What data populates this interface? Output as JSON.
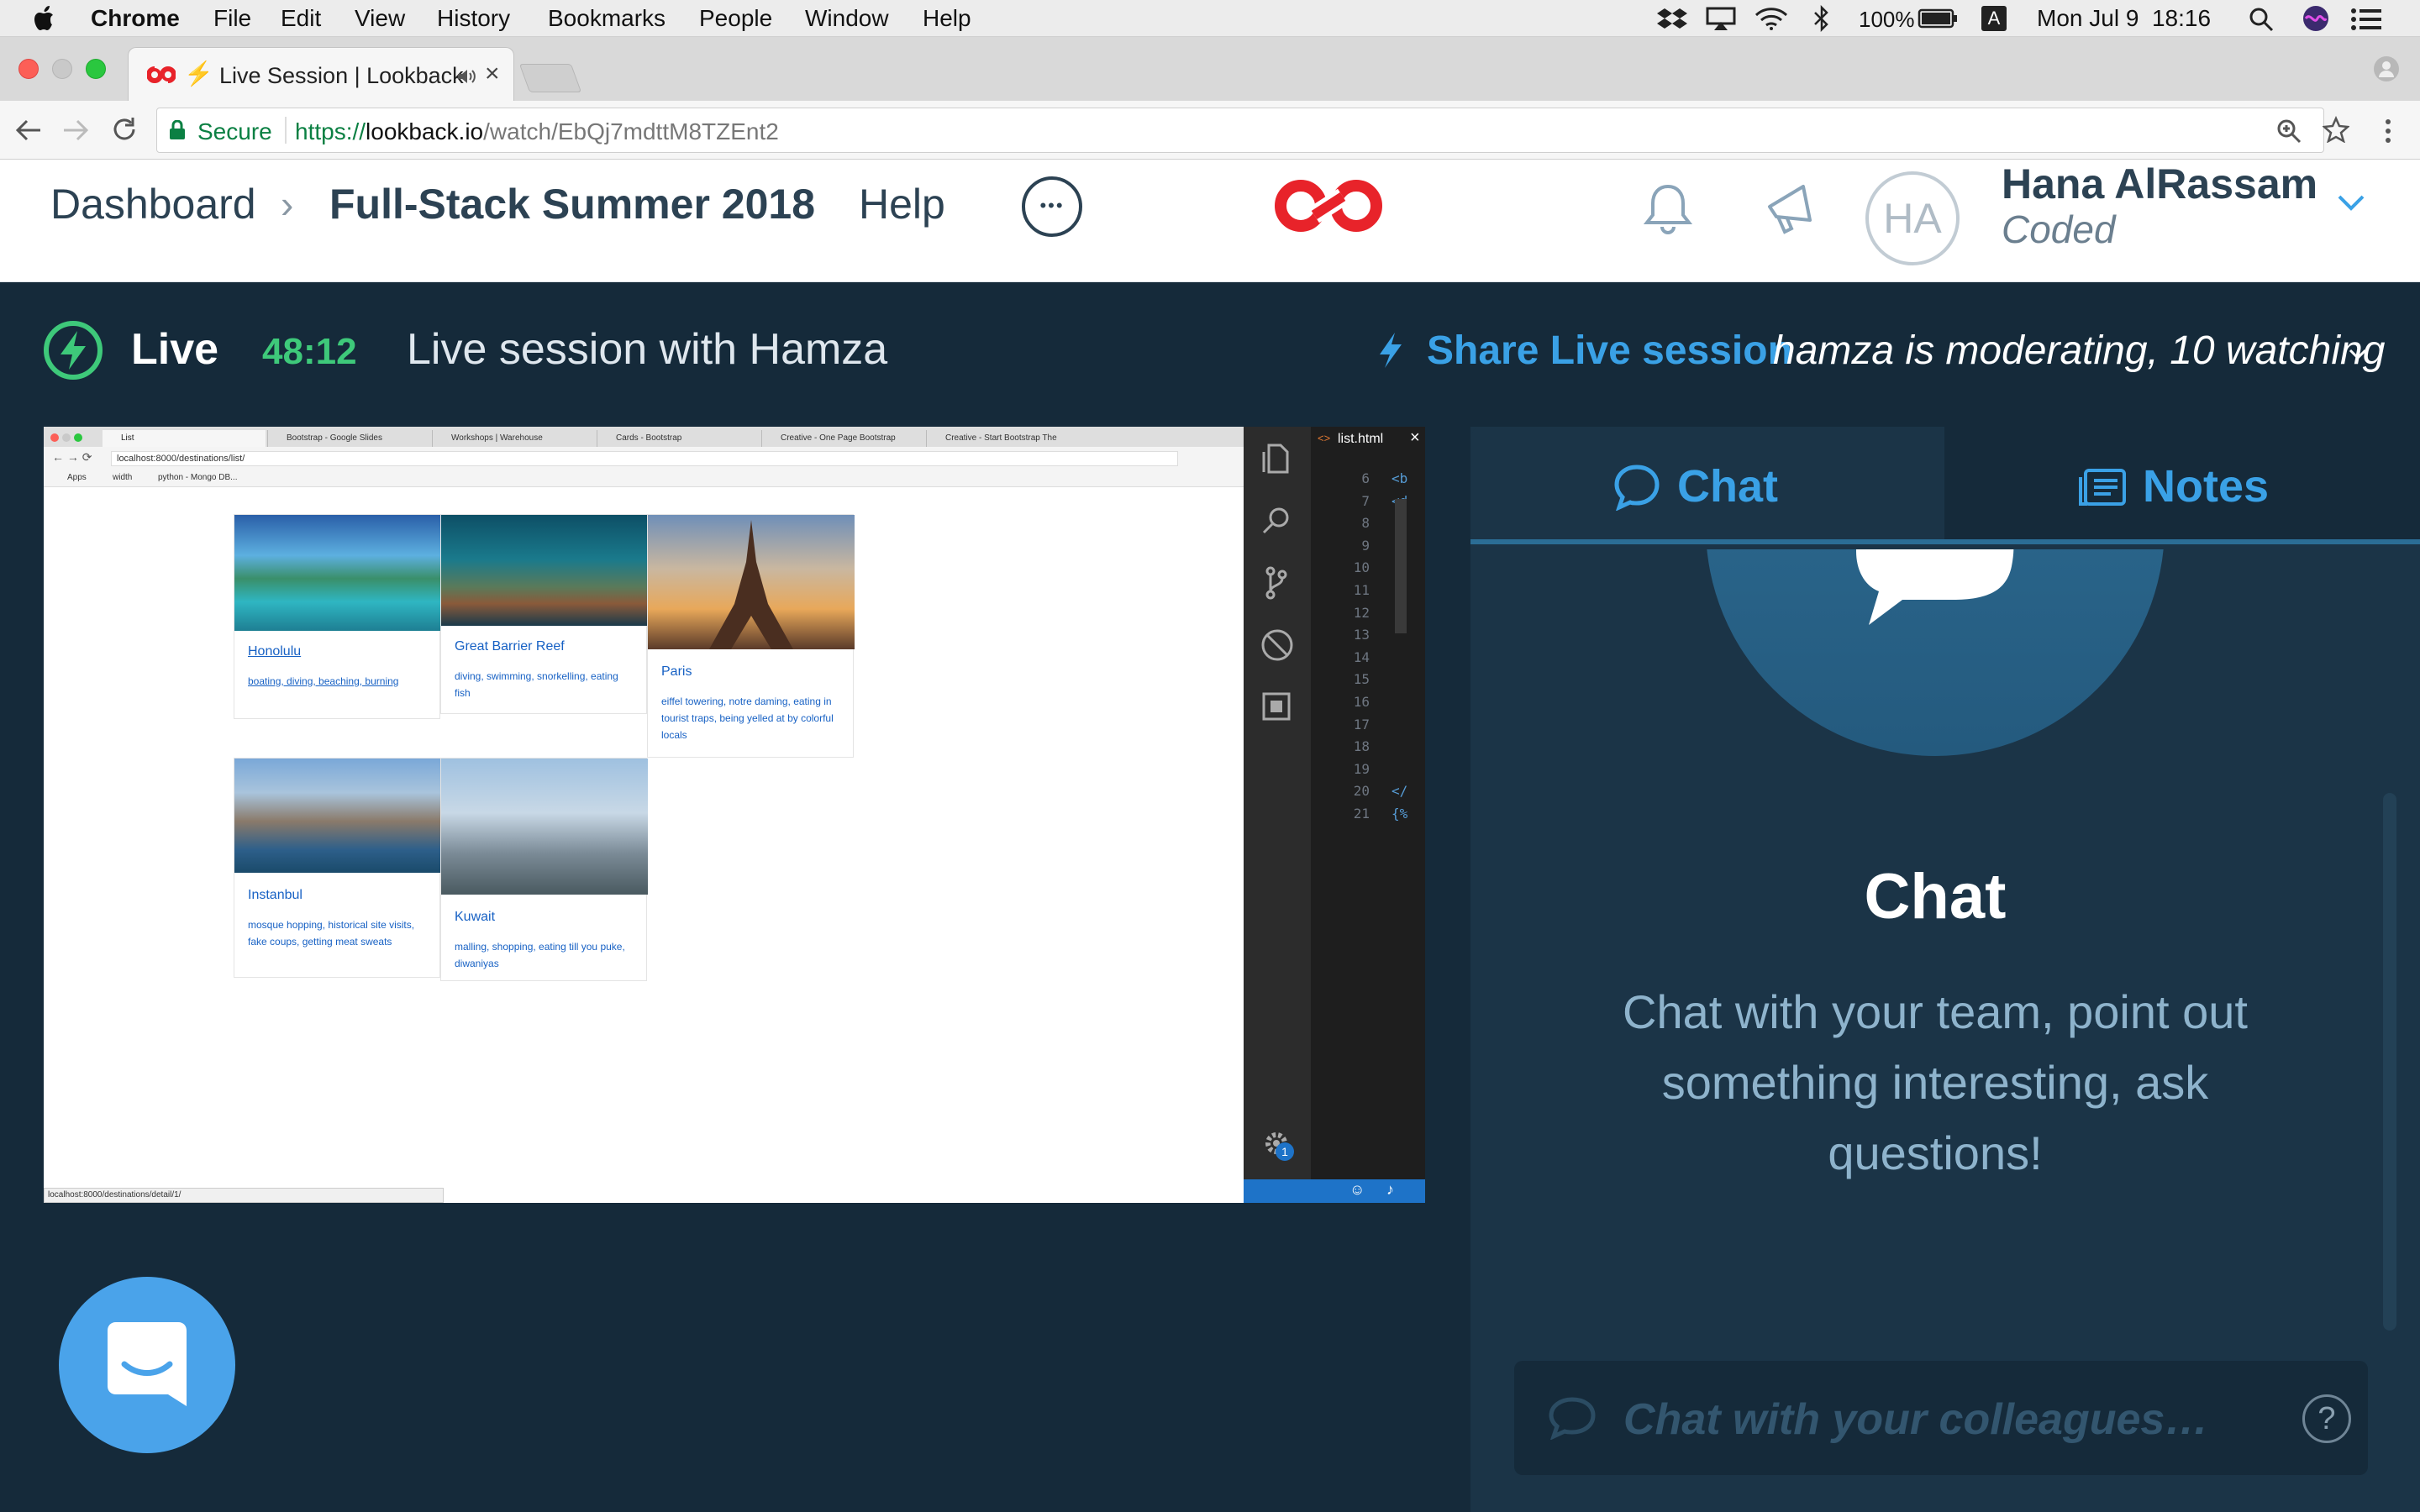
{
  "menubar": {
    "app": "Chrome",
    "items": [
      "File",
      "Edit",
      "View",
      "History",
      "Bookmarks",
      "People",
      "Window",
      "Help"
    ],
    "battery": "100%",
    "input_source": "A",
    "datetime": "Mon Jul 9  18:16"
  },
  "browser": {
    "tab_title": "Live Session | Lookback",
    "secure_label": "Secure",
    "url_scheme": "https://",
    "url_host": "lookback.io",
    "url_path": "/watch/EbQj7mdttM8TZEnt2"
  },
  "header": {
    "dashboard": "Dashboard",
    "breadcrumb_sep": "›",
    "project": "Full-Stack Summer 2018",
    "help": "Help",
    "more": "•••",
    "avatar_initials": "HA",
    "user_name": "Hana AlRassam",
    "user_org": "Coded",
    "colors": {
      "brand": "#e8232a",
      "text": "#2c4253"
    }
  },
  "session": {
    "live_label": "Live",
    "timer": "48:12",
    "title": "Live session with Hamza",
    "share_label": "Share Live session",
    "status": "hamza is moderating, 10 watching",
    "colors": {
      "live_green": "#3ec97a",
      "share_blue": "#3aa1e6"
    }
  },
  "shared_screen": {
    "tabs": [
      "List",
      "Bootstrap - Google Slides",
      "Workshops | Warehouse",
      "Cards - Bootstrap",
      "Creative - One Page Bootstrap",
      "Creative - Start Bootstrap The"
    ],
    "address": "localhost:8000/destinations/list/",
    "bookmarks": [
      "Apps",
      "width",
      "python - Mongo DB..."
    ],
    "status_url": "localhost:8000/destinations/detail/1/",
    "cards": [
      {
        "title": "Honolulu",
        "desc": "boating, diving, beaching, burning"
      },
      {
        "title": "Great Barrier Reef",
        "desc": "diving, swimming, snorkelling, eating fish"
      },
      {
        "title": "Paris",
        "desc": "eiffel towering, notre daming, eating in tourist traps, being yelled at by colorful locals"
      },
      {
        "title": "Instanbul",
        "desc": "mosque hopping, historical site visits, fake coups, getting meat sweats"
      },
      {
        "title": "Kuwait",
        "desc": "malling, shopping, eating till you puke, diwaniyas"
      }
    ],
    "editor_file": "list.html",
    "line_numbers": [
      "6",
      "7",
      "8",
      "9",
      "10",
      "11",
      "12",
      "13",
      "14",
      "15",
      "16",
      "17",
      "18",
      "19",
      "20",
      "21"
    ],
    "code_fragments": {
      "6": "<b",
      "7": "<d",
      "20": "</",
      "21": "{%"
    },
    "badge": "1"
  },
  "panel": {
    "tab_chat": "Chat",
    "tab_notes": "Notes",
    "heading": "Chat",
    "body_line1": "Chat with your team, point out",
    "body_line2": "something interesting, ask",
    "body_line3": "questions!",
    "input_placeholder": "Chat with your colleagues…",
    "help": "?"
  }
}
